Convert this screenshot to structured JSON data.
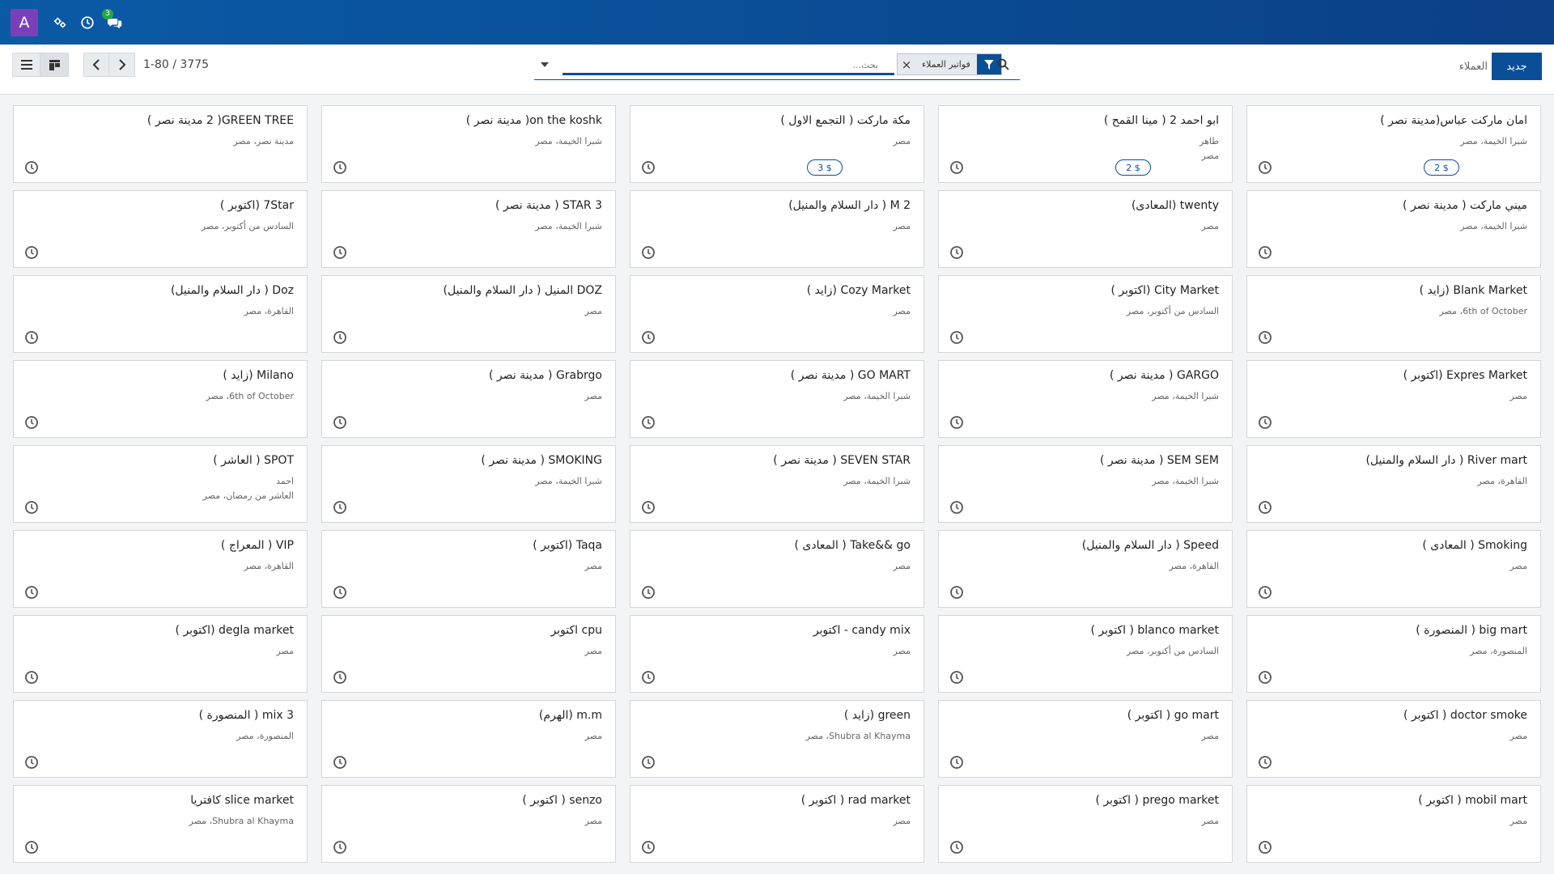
{
  "navbar": {
    "avatar_letter": "A",
    "icons": [
      "settings-icon",
      "clock-icon",
      "chat-icon"
    ],
    "chat_badge": "3"
  },
  "control_panel": {
    "pager_value": "1-80 / 3775",
    "search_placeholder": "بحث...",
    "facet_value": "فواتير العملاء",
    "breadcrumb": "العملاء",
    "new_button": "جديد"
  },
  "colors": {
    "navbar": "#0a4e97",
    "avatar": "#7b3fb8",
    "primary": "#0a4e97",
    "badge_green": "#28a745"
  },
  "cards": [
    {
      "title": "امان ماركت عباس(مدينة نصر )",
      "line1": "شبرا الخيمة، مصر",
      "badge": "2 $"
    },
    {
      "title": "ابو احمد 2 ( مينا القمح )",
      "line1": "طاهر",
      "line2": "مصر",
      "badge": "2 $"
    },
    {
      "title": "مكة ماركت ( التجمع الاول )",
      "line1": "مصر",
      "badge": "3 $"
    },
    {
      "title": "on the koshk( مدينة نصر )",
      "line1": "شبرا الخيمة، مصر"
    },
    {
      "title": "GREEN TREE( 2 مدينة نصر )",
      "line1": "مدينة نصر، مصر"
    },
    {
      "title": "ميني ماركت ( مدينة نصر )",
      "line1": "شبرا الخيمة، مصر"
    },
    {
      "title": "twenty (المعادى)",
      "line1": "مصر"
    },
    {
      "title": "M 2 ( دار السلام والمنيل)",
      "line1": "مصر"
    },
    {
      "title": "STAR 3 ( مدينة نصر )",
      "line1": "شبرا الخيمة، مصر"
    },
    {
      "title": "7Star (اكتوبر )",
      "line1": "السادس من أكتوبر، مصر"
    },
    {
      "title": "Blank Market (زايد )",
      "line1": "6th of October، مصر"
    },
    {
      "title": "City Market (اكتوبر )",
      "line1": "السادس من أكتوبر، مصر"
    },
    {
      "title": "Cozy Market (زايد )",
      "line1": "مصر"
    },
    {
      "title": "DOZ المنيل ( دار السلام والمنيل)",
      "line1": "مصر"
    },
    {
      "title": "Doz ( دار السلام والمنيل)",
      "line1": "القاهرة، مصر"
    },
    {
      "title": "Expres Market (اكتوبر )",
      "line1": "مصر"
    },
    {
      "title": "GARGO ( مدينة نصر )",
      "line1": "شبرا الخيمة، مصر"
    },
    {
      "title": "GO MART ( مدينة نصر )",
      "line1": "شبرا الخيمة، مصر"
    },
    {
      "title": "Grabrgo ( مدينة نصر )",
      "line1": "مصر"
    },
    {
      "title": "Milano (زايد )",
      "line1": "6th of October، مصر"
    },
    {
      "title": "River mart ( دار السلام والمنيل)",
      "line1": "القاهرة، مصر"
    },
    {
      "title": "SEM SEM ( مدينة نصر )",
      "line1": "شبرا الخيمة، مصر"
    },
    {
      "title": "SEVEN STAR ( مدينة نصر )",
      "line1": "شبرا الخيمة، مصر"
    },
    {
      "title": "SMOKING ( مدينة نصر )",
      "line1": "شبرا الخيمة، مصر"
    },
    {
      "title": "SPOT ( العاشر )",
      "line1": "احمد",
      "line2": "العاشر من رمضان، مصر"
    },
    {
      "title": "Smoking ( المعادى )",
      "line1": "مصر"
    },
    {
      "title": "Speed ( دار السلام والمنيل)",
      "line1": "القاهرة، مصر"
    },
    {
      "title": "Take&& go ( المعادى )",
      "line1": "مصر"
    },
    {
      "title": "Taqa (اكتوبر )",
      "line1": "مصر"
    },
    {
      "title": "VIP ( المعراج )",
      "line1": "القاهرة، مصر"
    },
    {
      "title": "big mart ( المنصورة )",
      "line1": "المنصورة، مصر"
    },
    {
      "title": "blanco market ( اكتوبر )",
      "line1": "السادس من أكتوبر، مصر"
    },
    {
      "title": "candy mix - اكتوبر",
      "line1": "مصر"
    },
    {
      "title": "cpu اكتوبر",
      "line1": "مصر"
    },
    {
      "title": "degla market (اكتوبر )",
      "line1": "مصر"
    },
    {
      "title": "doctor smoke ( اكتوبر )",
      "line1": "مصر"
    },
    {
      "title": "go mart ( اكتوبر )",
      "line1": "مصر"
    },
    {
      "title": "green (زايد )",
      "line1": "Shubra al Khayma، مصر"
    },
    {
      "title": "m.m (الهرم)",
      "line1": "مصر"
    },
    {
      "title": "mix 3 ( المنصورة )",
      "line1": "المنصورة، مصر"
    },
    {
      "title": "mobil mart ( اكتوبر )",
      "line1": "مصر"
    },
    {
      "title": "prego market ( اكتوبر )",
      "line1": "مصر"
    },
    {
      "title": "rad market ( اكتوبر )",
      "line1": "مصر"
    },
    {
      "title": "senzo ( اكتوبر )",
      "line1": "مصر"
    },
    {
      "title": "slice market كافتريا",
      "line1": "Shubra al Khayma، مصر"
    }
  ]
}
